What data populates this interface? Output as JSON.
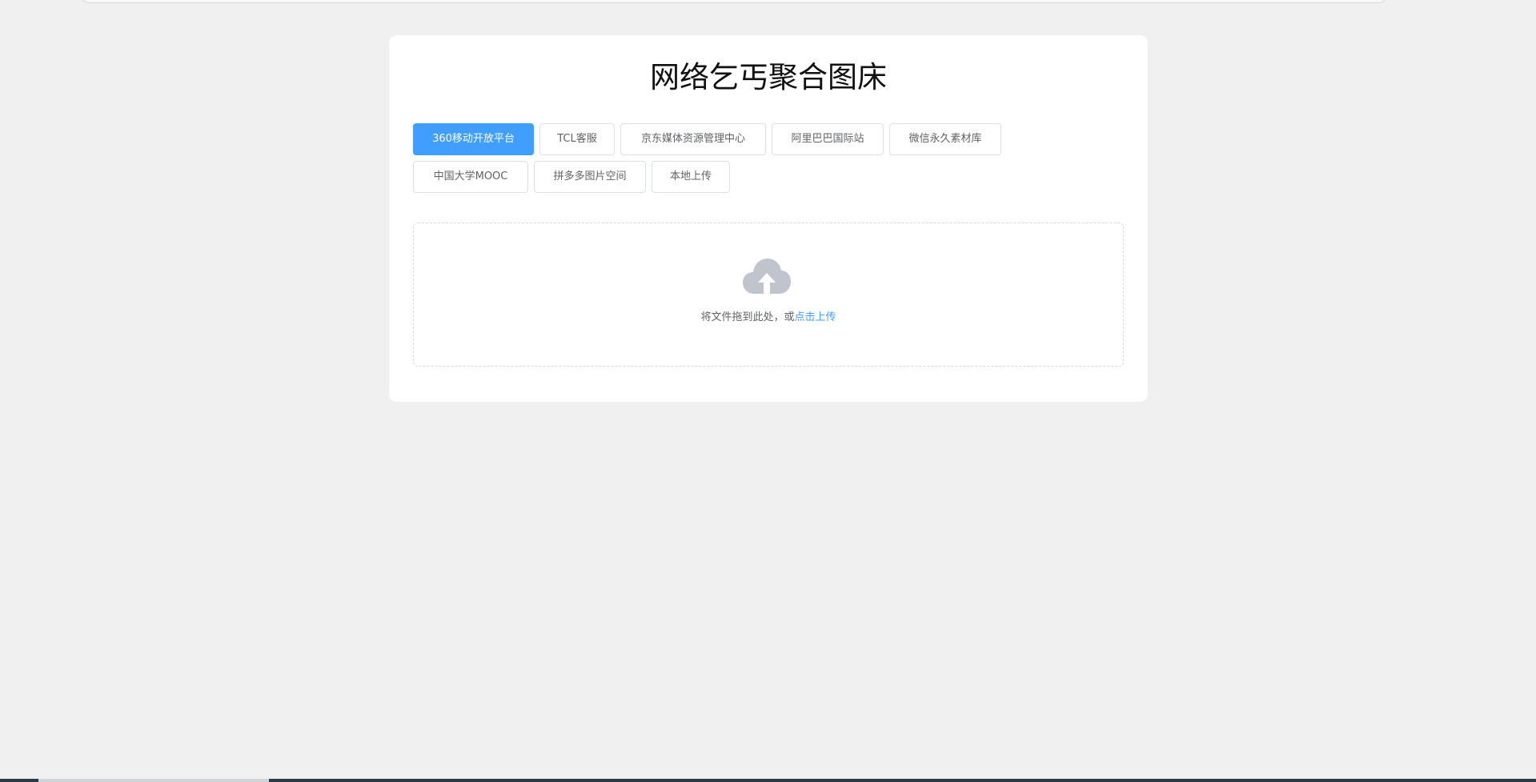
{
  "page": {
    "title": "网络乞丐聚合图床"
  },
  "platforms": [
    {
      "label": "360移动开放平台",
      "active": true
    },
    {
      "label": "TCL客服",
      "active": false
    },
    {
      "label": "京东媒体资源管理中心",
      "active": false
    },
    {
      "label": "阿里巴巴国际站",
      "active": false
    },
    {
      "label": "微信永久素材库",
      "active": false
    },
    {
      "label": "中国大学MOOC",
      "active": false
    },
    {
      "label": "拼多多图片空间",
      "active": false
    },
    {
      "label": "本地上传",
      "active": false
    }
  ],
  "upload": {
    "icon": "cloud-upload-icon",
    "hint": "将文件拖到此处，或",
    "link": "点击上传"
  },
  "colors": {
    "accent": "#409eff",
    "background": "#f0f0f0",
    "card": "#ffffff",
    "icon": "#c0c4cc"
  }
}
